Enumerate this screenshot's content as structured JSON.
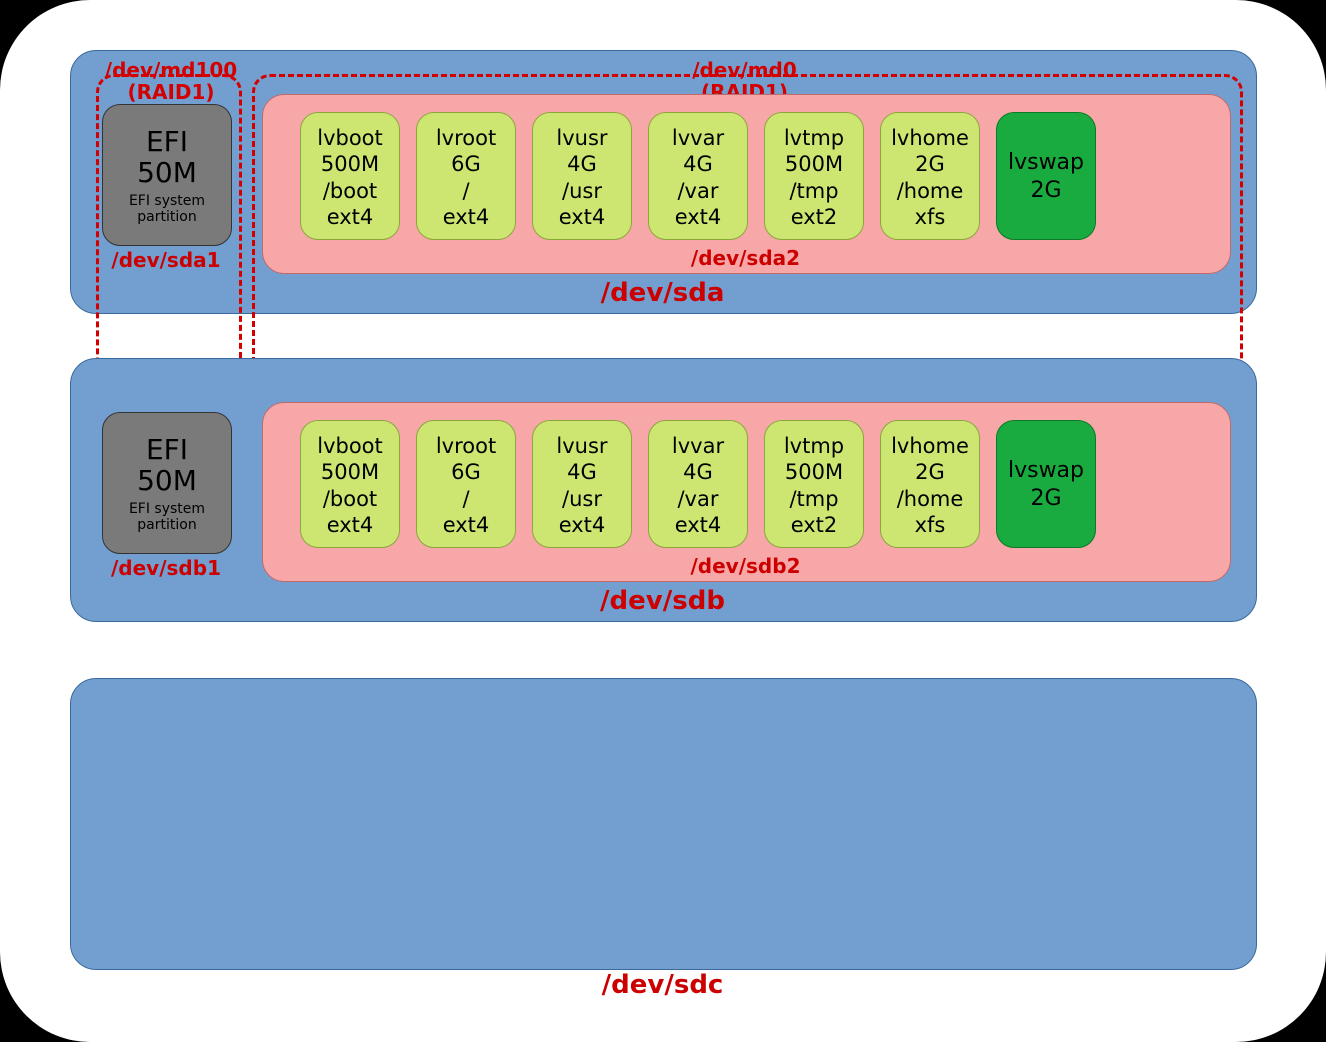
{
  "raid": {
    "md100_name": "/dev/md100",
    "md100_type": "(RAID1)",
    "md0_name": "/dev/md0",
    "md0_type": "(RAID1)"
  },
  "disks": [
    {
      "name": "/dev/sda"
    },
    {
      "name": "/dev/sdb"
    },
    {
      "name": "/dev/sdc"
    }
  ],
  "efi": {
    "title": "EFI",
    "size": "50M",
    "subtitle": "EFI system\npartition"
  },
  "efi_labels": {
    "sda": "/dev/sda1",
    "sdb": "/dev/sdb1"
  },
  "pv_labels": {
    "sda": "/dev/sda2",
    "sdb": "/dev/sdb2"
  },
  "lvs": [
    {
      "name": "lvboot",
      "size": "500M",
      "mount": "/boot",
      "fs": "ext4"
    },
    {
      "name": "lvroot",
      "size": "6G",
      "mount": "/",
      "fs": "ext4"
    },
    {
      "name": "lvusr",
      "size": "4G",
      "mount": "/usr",
      "fs": "ext4"
    },
    {
      "name": "lvvar",
      "size": "4G",
      "mount": "/var",
      "fs": "ext4"
    },
    {
      "name": "lvtmp",
      "size": "500M",
      "mount": "/tmp",
      "fs": "ext2"
    },
    {
      "name": "lvhome",
      "size": "2G",
      "mount": "/home",
      "fs": "xfs"
    }
  ],
  "swap": {
    "name": "lvswap",
    "size": "2G"
  }
}
